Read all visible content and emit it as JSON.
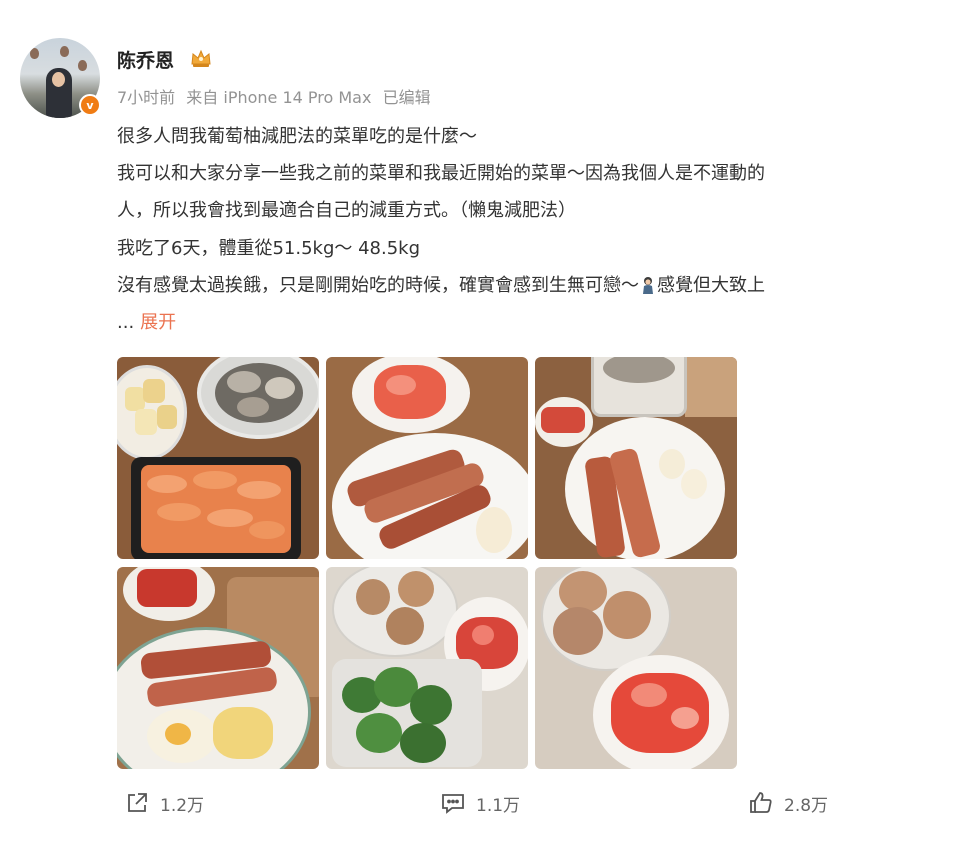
{
  "post": {
    "author": "陈乔恩",
    "time": "7小时前",
    "source": "来自 iPhone 14 Pro Max",
    "edited": "已编辑",
    "lines": [
      "很多人問我葡萄柚減肥法的菜單吃的是什麼～",
      "我可以和大家分享一些我之前的菜單和我最近開始的菜單～因為我個人是不運動的",
      "人，所以我會找到最適合自己的減重方式。（懶鬼減肥法）",
      "我吃了6天，體重從51.5kg～ 48.5kg",
      "沒有感覺太過挨餓，只是剛開始吃的時候，確實會感到生無可戀～",
      "感覺但大致上"
    ],
    "ellipsis": "...",
    "expand": "展开",
    "avatar_badge": "v"
  },
  "icons": {
    "crown": "crown-icon",
    "emoji": "person-emoji-icon",
    "share": "share-icon",
    "comment": "comment-icon",
    "like": "thumbs-up-icon"
  },
  "actions": {
    "share_count": "1.2万",
    "comment_count": "1.1万",
    "like_count": "2.8万"
  },
  "colors": {
    "accent": "#eb7350",
    "badge": "#f07c14",
    "meta": "#939393"
  }
}
